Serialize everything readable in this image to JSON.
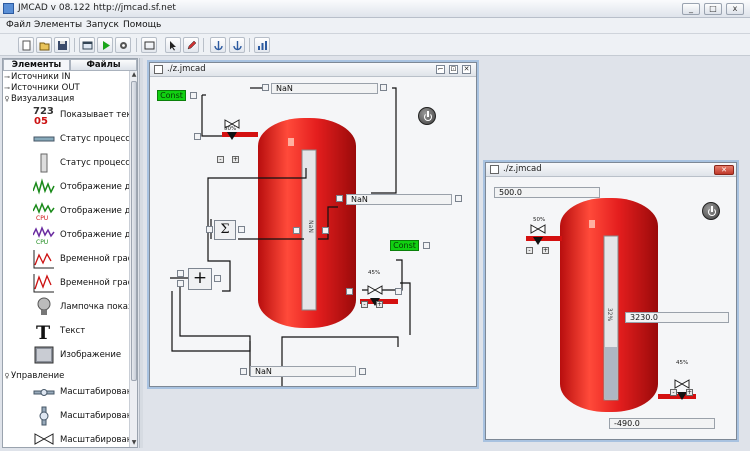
{
  "app": {
    "title": "JMCAD v 08.122 http://jmcad.sf.net",
    "window_buttons": [
      "_",
      "□",
      "x"
    ]
  },
  "menu": [
    "Файл",
    "Элементы",
    "Запуск",
    "Помощь"
  ],
  "toolbar": {
    "icons": [
      "new-file-icon",
      "open-folder-icon",
      "save-icon",
      "properties-icon",
      "run-icon",
      "settings-gear-icon",
      "frame-icon",
      "pointer-icon",
      "pencil-icon",
      "anchor-icon",
      "anchor2-icon",
      "chart-icon"
    ]
  },
  "left_panel": {
    "tabs": [
      "Элементы",
      "Файлы"
    ],
    "groups": {
      "inputs": "Источники IN",
      "outputs": "Источники OUT",
      "visualization": "Визуализация",
      "control": "Управление"
    },
    "visualization_items": [
      {
        "label": "Показывает теку",
        "icon": "digits-display-icon"
      },
      {
        "label": "Статус процесса",
        "icon": "status-bar-icon"
      },
      {
        "label": "Статус процесса",
        "icon": "status-tube-icon"
      },
      {
        "label": "Отображение дан",
        "icon": "wave-chart-icon"
      },
      {
        "label": "Отображение дан",
        "icon": "cpu-chart-icon"
      },
      {
        "label": "Отображение дан",
        "icon": "cpu-chart-purple-icon"
      },
      {
        "label": "Временной графи",
        "icon": "time-graph-icon"
      },
      {
        "label": "Временной графи",
        "icon": "time-graph2-icon"
      },
      {
        "label": "Лампочка показы",
        "icon": "lamp-icon"
      },
      {
        "label": "Текст",
        "icon": "text-t-icon"
      },
      {
        "label": "Изображение",
        "icon": "image-icon"
      }
    ],
    "control_items": [
      {
        "label": "Масштабирование",
        "icon": "scale-horizontal-icon"
      },
      {
        "label": "Масштабирование",
        "icon": "scale-vertical-icon"
      },
      {
        "label": "Масштабирование",
        "icon": "valve-icon"
      }
    ]
  },
  "window1": {
    "title": "./z.jmcad",
    "const1": "Const",
    "const2": "Const",
    "field_top": "NaN",
    "field_mid": "NaN",
    "field_bottom": "NaN",
    "sum_symbol": "Σ",
    "plus_symbol": "+",
    "tank_level_label": "NaN",
    "valve1_pct": "50%",
    "valve2_pct": "45%"
  },
  "window2": {
    "title": "./z.jmcad",
    "field_top": "500.0",
    "field_mid": "3230.0",
    "field_bottom": "-490.0",
    "tank_level_label": "32%",
    "tank_level_fraction": 0.32,
    "valve1_pct": "50%",
    "valve2_pct": "45%"
  },
  "colors": {
    "tank_red": "#e41e1e",
    "const_green": "#11d011",
    "window_border_blue": "#a8c2e0"
  }
}
